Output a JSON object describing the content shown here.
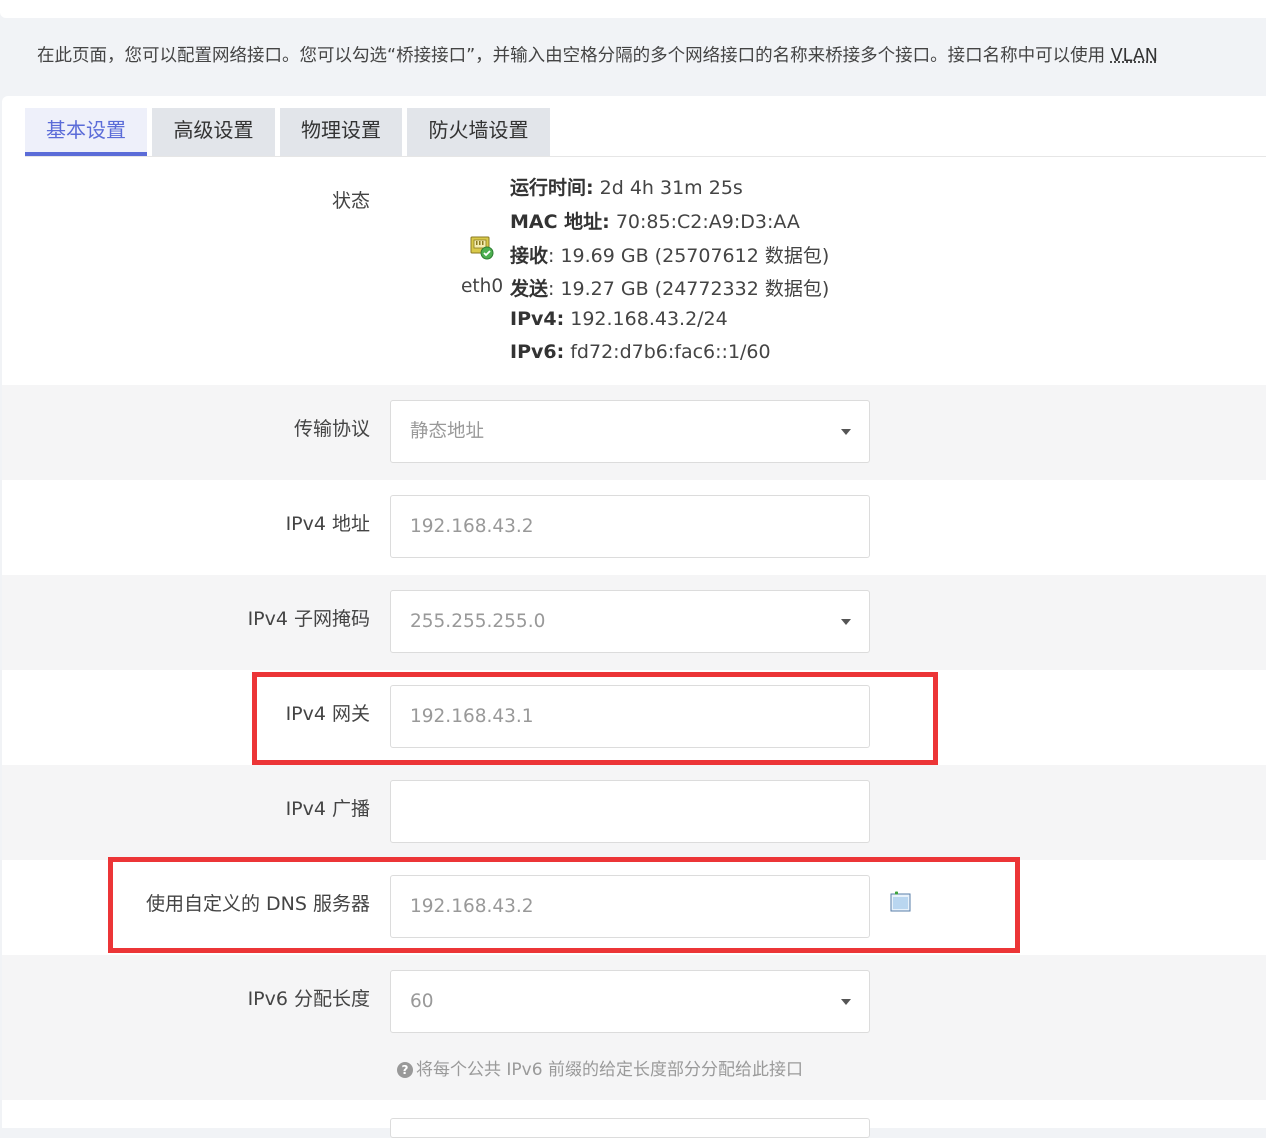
{
  "description": {
    "text": "在此页面，您可以配置网络接口。您可以勾选“桥接接口”，并输入由空格分隔的多个网络接口的名称来桥接多个接口。接口名称中可以使用 ",
    "link": "VLAN"
  },
  "tabs": [
    {
      "label": "基本设置",
      "active": true
    },
    {
      "label": "高级设置",
      "active": false
    },
    {
      "label": "物理设置",
      "active": false
    },
    {
      "label": "防火墙设置",
      "active": false
    }
  ],
  "status": {
    "label": "状态",
    "device": "eth0",
    "lines": [
      {
        "key": "运行时间:",
        "value": " 2d 4h 31m 25s"
      },
      {
        "key": "MAC 地址:",
        "value": " 70:85:C2:A9:D3:AA"
      },
      {
        "key": "接收",
        "value": ": 19.69 GB (25707612 数据包)"
      },
      {
        "key": "发送",
        "value": ": 19.27 GB (24772332 数据包)"
      },
      {
        "key": "IPv4:",
        "value": " 192.168.43.2/24"
      },
      {
        "key": "IPv6:",
        "value": " fd72:d7b6:fac6::1/60"
      }
    ]
  },
  "form": {
    "protocol": {
      "label": "传输协议",
      "value": "静态地址"
    },
    "ipv4_address": {
      "label": "IPv4 地址",
      "value": "192.168.43.2"
    },
    "ipv4_netmask": {
      "label": "IPv4 子网掩码",
      "value": "255.255.255.0"
    },
    "ipv4_gateway": {
      "label": "IPv4 网关",
      "value": "192.168.43.1"
    },
    "ipv4_broadcast": {
      "label": "IPv4 广播",
      "value": ""
    },
    "dns": {
      "label": "使用自定义的 DNS 服务器",
      "value": "192.168.43.2"
    },
    "ipv6_assign": {
      "label": "IPv6 分配长度",
      "value": "60",
      "hint": "将每个公共 IPv6 前缀的给定长度部分分配给此接口"
    }
  },
  "colors": {
    "accent": "#5b6cd8",
    "highlight": "#ec3537"
  }
}
